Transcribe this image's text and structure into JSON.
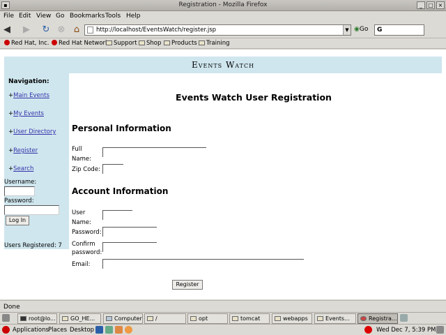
{
  "window": {
    "title": "Registration - Mozilla Firefox"
  },
  "menu": [
    "File",
    "Edit",
    "View",
    "Go",
    "Bookmarks",
    "Tools",
    "Help"
  ],
  "toolbar": {
    "url": "http://localhost/EventsWatch/register.jsp",
    "go_label": "Go",
    "search_placeholder": "G"
  },
  "bookmarks": [
    "Red Hat, Inc.",
    "Red Hat Network",
    "Support",
    "Shop",
    "Products",
    "Training"
  ],
  "page": {
    "brand": "Events Watch",
    "title": "Events Watch User Registration",
    "nav": {
      "heading": "Navigation:",
      "links": [
        "Main Events",
        "My Events",
        "User Directory",
        "Register",
        "Search"
      ],
      "prefix": "+"
    },
    "login": {
      "username_label": "Username:",
      "password_label": "Password:",
      "button": "Log In",
      "users_registered": "Users Registered: 7"
    },
    "personal": {
      "heading": "Personal Information",
      "full_name_label_1": "Full",
      "full_name_label_2": "Name:",
      "zip_label": "Zip Code:"
    },
    "account": {
      "heading": "Account Information",
      "user_name_label_1": "User",
      "user_name_label_2": "Name:",
      "password_label": "Password:",
      "confirm_label_1": "Confirm",
      "confirm_label_2": "password:",
      "email_label": "Email:"
    },
    "register_button": "Register"
  },
  "status": {
    "text": "Done"
  },
  "taskbar": [
    "root@lo...",
    "GO_HE...",
    "Computer",
    "/",
    "opt",
    "tomcat",
    "webapps",
    "Events...",
    "Registra..."
  ],
  "panel": {
    "applications": "Applications",
    "places": "Places",
    "desktop": "Desktop",
    "clock": "Wed Dec  7,  5:39 PM"
  }
}
